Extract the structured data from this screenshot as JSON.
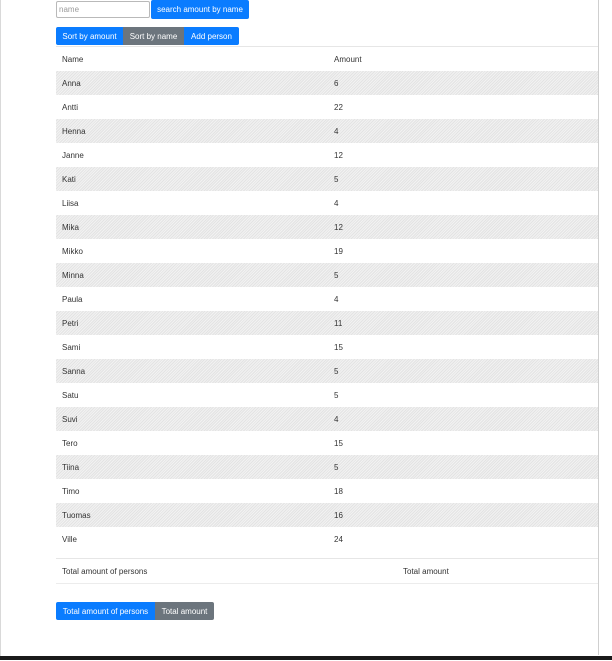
{
  "search": {
    "placeholder": "name",
    "value": "",
    "button_label": "search amount by name"
  },
  "sort_buttons": {
    "by_amount": "Sort by amount",
    "by_name": "Sort by name",
    "add_person": "Add person"
  },
  "table": {
    "headers": {
      "name": "Name",
      "amount": "Amount"
    },
    "rows": [
      {
        "name": "Anna",
        "amount": "6"
      },
      {
        "name": "Antti",
        "amount": "22"
      },
      {
        "name": "Henna",
        "amount": "4"
      },
      {
        "name": "Janne",
        "amount": "12"
      },
      {
        "name": "Kati",
        "amount": "5"
      },
      {
        "name": "Liisa",
        "amount": "4"
      },
      {
        "name": "Mika",
        "amount": "12"
      },
      {
        "name": "Mikko",
        "amount": "19"
      },
      {
        "name": "Minna",
        "amount": "5"
      },
      {
        "name": "Paula",
        "amount": "4"
      },
      {
        "name": "Petri",
        "amount": "11"
      },
      {
        "name": "Sami",
        "amount": "15"
      },
      {
        "name": "Sanna",
        "amount": "5"
      },
      {
        "name": "Satu",
        "amount": "5"
      },
      {
        "name": "Suvi",
        "amount": "4"
      },
      {
        "name": "Tero",
        "amount": "15"
      },
      {
        "name": "Tiina",
        "amount": "5"
      },
      {
        "name": "Timo",
        "amount": "18"
      },
      {
        "name": "Tuomas",
        "amount": "16"
      },
      {
        "name": "Ville",
        "amount": "24"
      }
    ]
  },
  "totals": {
    "persons_label": "Total amount of persons",
    "amount_label": "Total amount"
  },
  "bottom_buttons": {
    "total_persons": "Total amount of persons",
    "total_amount": "Total amount"
  },
  "colors": {
    "primary": "#0a7cff",
    "secondary": "#6c757d"
  }
}
